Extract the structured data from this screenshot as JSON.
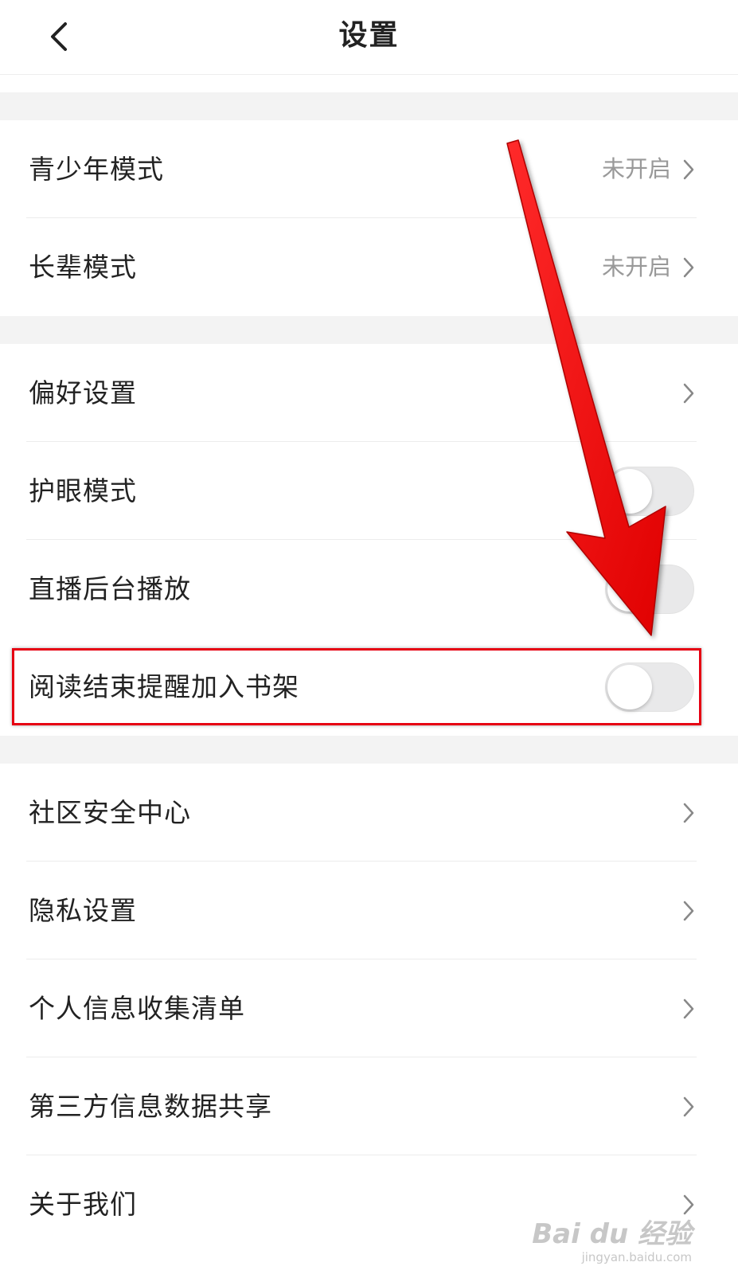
{
  "header": {
    "title": "设置",
    "back_icon": "chevron-left-icon"
  },
  "sections": [
    {
      "rows": [
        {
          "label": "青少年模式",
          "value": "未开启",
          "control": "chevron"
        },
        {
          "label": "长辈模式",
          "value": "未开启",
          "control": "chevron"
        }
      ]
    },
    {
      "rows": [
        {
          "label": "偏好设置",
          "control": "chevron"
        },
        {
          "label": "护眼模式",
          "control": "toggle",
          "on": false
        },
        {
          "label": "直播后台播放",
          "control": "toggle",
          "on": false
        },
        {
          "label": "阅读结束提醒加入书架",
          "control": "toggle",
          "on": false,
          "highlighted": true
        }
      ]
    },
    {
      "rows": [
        {
          "label": "社区安全中心",
          "control": "chevron"
        },
        {
          "label": "隐私设置",
          "control": "chevron"
        },
        {
          "label": "个人信息收集清单",
          "control": "chevron"
        },
        {
          "label": "第三方信息数据共享",
          "control": "chevron"
        },
        {
          "label": "关于我们",
          "control": "chevron"
        }
      ]
    }
  ],
  "annotation": {
    "highlight_color": "#e60012",
    "arrow_color": "#ff0000"
  },
  "watermark": {
    "logo": "Bai du 经验",
    "url": "jingyan.baidu.com"
  }
}
